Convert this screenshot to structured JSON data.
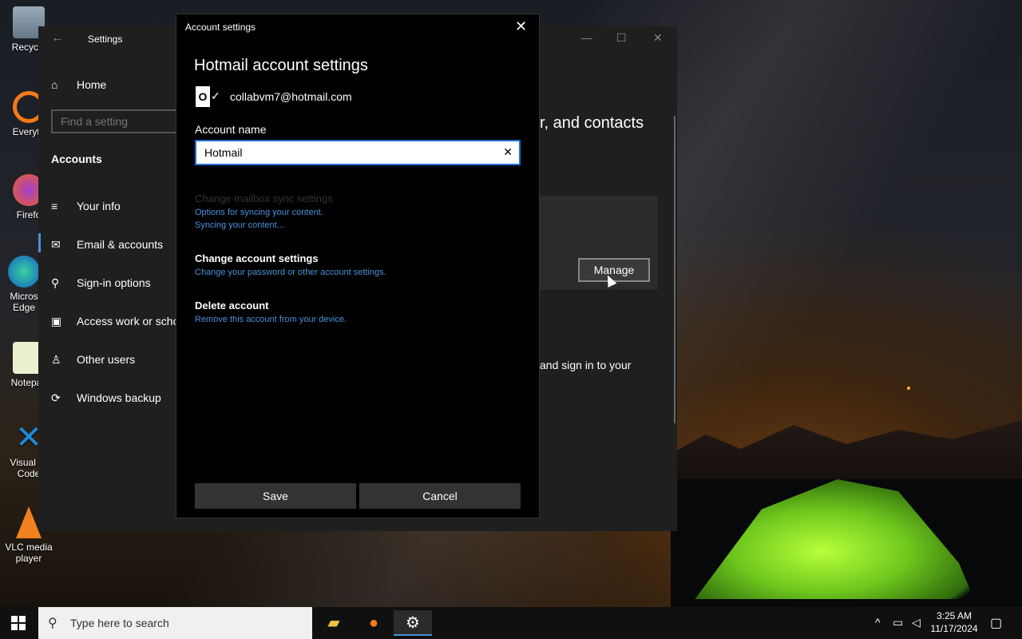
{
  "desktop": {
    "icons": [
      {
        "label": "Recycle"
      },
      {
        "label": "Everyth"
      },
      {
        "label": "Firefo"
      },
      {
        "label": "Micros Edge"
      },
      {
        "label": "Notepac"
      },
      {
        "label": "Visual St Code"
      },
      {
        "label": "VLC media player"
      }
    ]
  },
  "settings": {
    "title": "Settings",
    "back": "←",
    "min": "—",
    "max": "☐",
    "close": "✕",
    "home": "Home",
    "find_placeholder": "Find a setting",
    "section": "Accounts",
    "nav": [
      {
        "label": "Your info",
        "icon": "≡"
      },
      {
        "label": "Email & accounts",
        "icon": "✉"
      },
      {
        "label": "Sign-in options",
        "icon": "⚲"
      },
      {
        "label": "Access work or scho",
        "icon": "▣"
      },
      {
        "label": "Other users",
        "icon": "♙"
      },
      {
        "label": "Windows backup",
        "icon": "⟳"
      }
    ],
    "right_heading": "r, and contacts",
    "right_text": "and sign in to your",
    "manage": "Manage"
  },
  "dialog": {
    "title": "Account settings",
    "close": "✕",
    "heading": "Hotmail account settings",
    "email": "collabvm7@hotmail.com",
    "account_name_label": "Account name",
    "account_name_value": "Hotmail",
    "clear": "✕",
    "sync_title": "Change mailbox sync settings",
    "sync_desc1": "Options for syncing your content.",
    "sync_desc2": "Syncing your content...",
    "change_title": "Change account settings",
    "change_desc": "Change your password or other account settings.",
    "delete_title": "Delete account",
    "delete_desc": "Remove this account from your device.",
    "save": "Save",
    "cancel": "Cancel"
  },
  "taskbar": {
    "search_placeholder": "Type here to search",
    "time": "3:25 AM",
    "date": "11/17/2024"
  },
  "colors": {
    "accent": "#4a90d9",
    "dialog_bg": "#000000",
    "window_bg": "#1f1f1f"
  }
}
